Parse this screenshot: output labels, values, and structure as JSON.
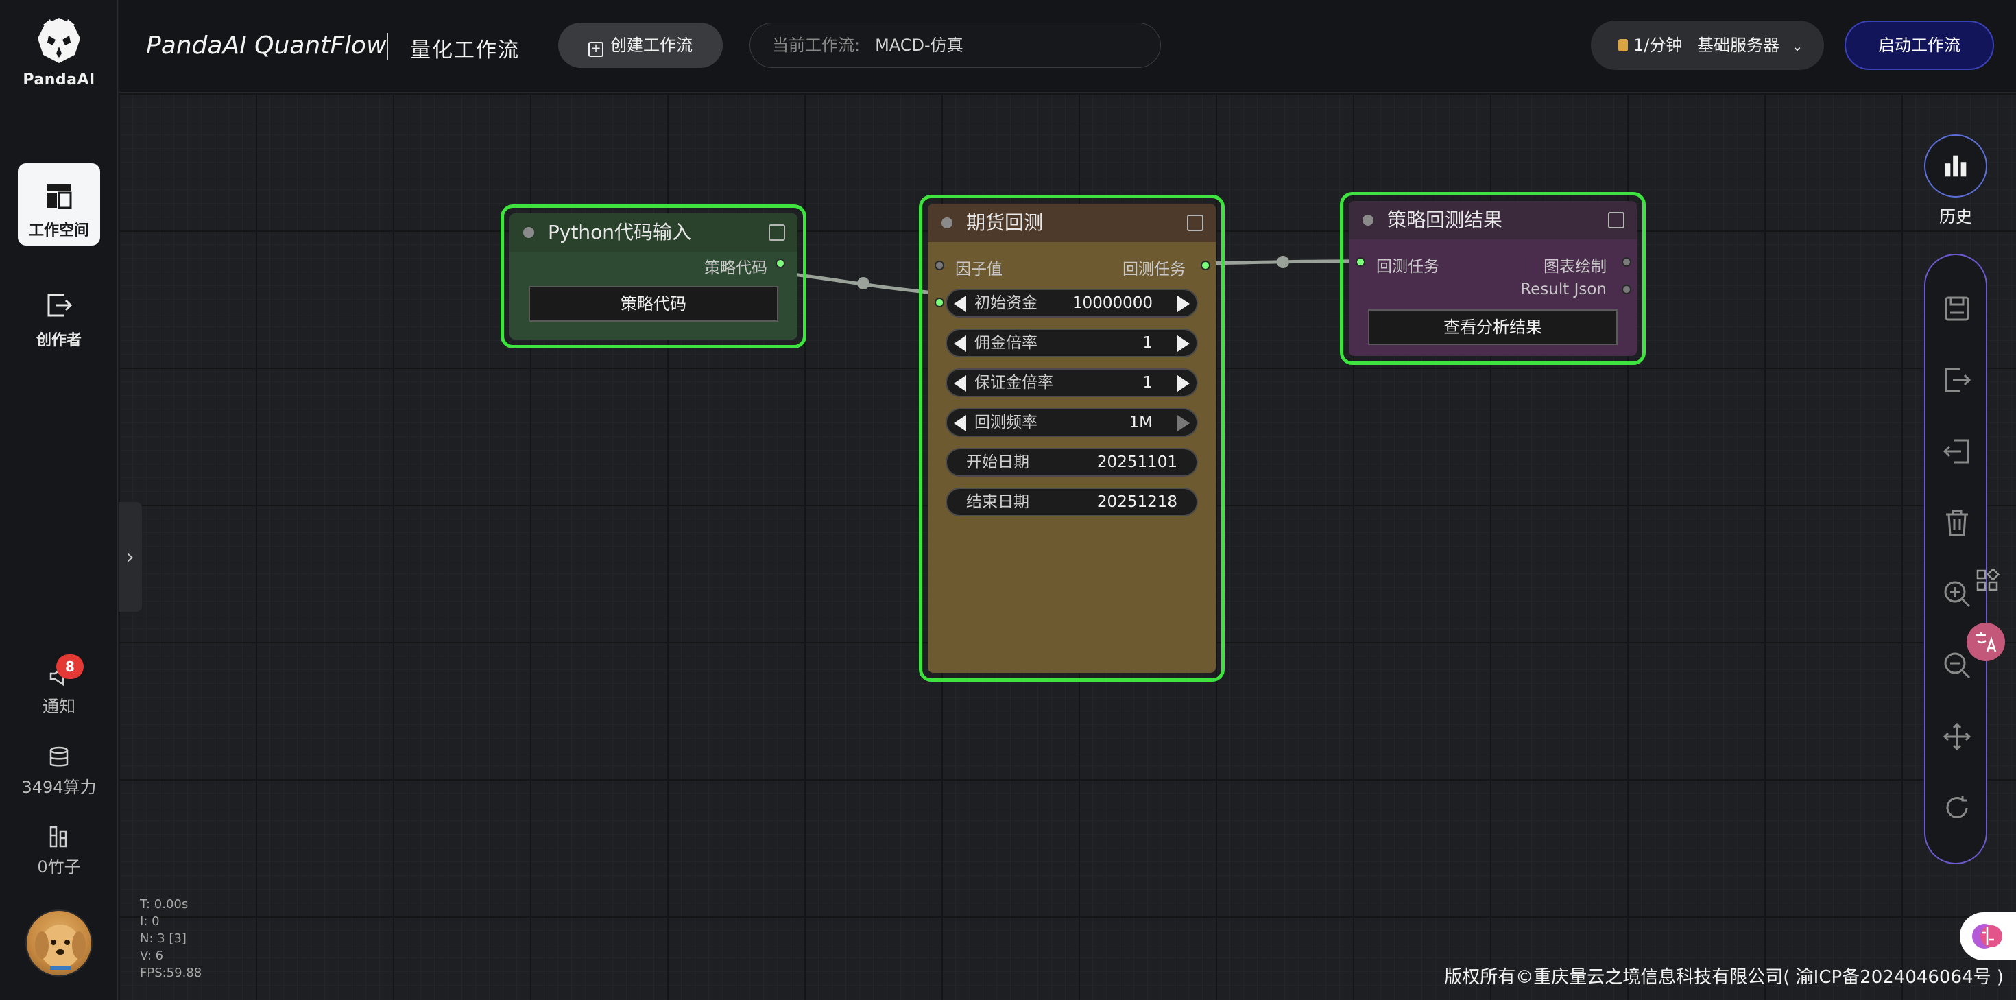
{
  "sidebar": {
    "logo_text": "PandaAI",
    "items": [
      {
        "label": "工作空间",
        "icon": "workspace-icon",
        "active": true
      },
      {
        "label": "创作者",
        "icon": "creator-icon",
        "active": false
      }
    ],
    "notification": {
      "label": "通知",
      "badge": "8",
      "icon": "megaphone-icon"
    },
    "compute": {
      "label": "3494算力",
      "icon": "database-icon"
    },
    "bamboo": {
      "label": "0竹子",
      "icon": "bamboo-icon"
    },
    "avatar": "dog-avatar"
  },
  "header": {
    "brand": "PandaAI QuantFlow",
    "subtitle": "量化工作流",
    "create_button": "创建工作流",
    "current_flow_label": "当前工作流:",
    "current_flow_value": "MACD-仿真",
    "server_rate": "1/分钟",
    "server_name": "基础服务器",
    "start_button": "启动工作流"
  },
  "nodes": {
    "python": {
      "title": "Python代码输入",
      "output": "策略代码",
      "button": "策略代码",
      "color": "#2f4a32"
    },
    "futures": {
      "title": "期货回测",
      "input": "因子值",
      "output": "回测任务",
      "color": "#6e5a30",
      "fields": [
        {
          "label": "初始资金",
          "value": "10000000"
        },
        {
          "label": "佣金倍率",
          "value": "1"
        },
        {
          "label": "保证金倍率",
          "value": "1"
        },
        {
          "label": "回测频率",
          "value": "1M"
        },
        {
          "label": "开始日期",
          "value": "20251101"
        },
        {
          "label": "结束日期",
          "value": "20251218"
        }
      ]
    },
    "result": {
      "title": "策略回测结果",
      "input": "回测任务",
      "output1": "图表绘制",
      "output2": "Result Json",
      "button": "查看分析结果",
      "color": "#4a2c4c"
    }
  },
  "right_toolbar": {
    "history_label": "历史",
    "tools": [
      "save-icon",
      "export-icon",
      "import-icon",
      "delete-icon",
      "zoom-in-icon",
      "zoom-out-icon",
      "move-icon",
      "refresh-icon"
    ]
  },
  "stats": {
    "t": "T: 0.00s",
    "i": "I: 0",
    "n": "N: 3 [3]",
    "v": "V: 6",
    "fps": "FPS:59.88"
  },
  "footer": "版权所有©重庆量云之境信息科技有限公司( 渝ICP备2024046064号 )"
}
